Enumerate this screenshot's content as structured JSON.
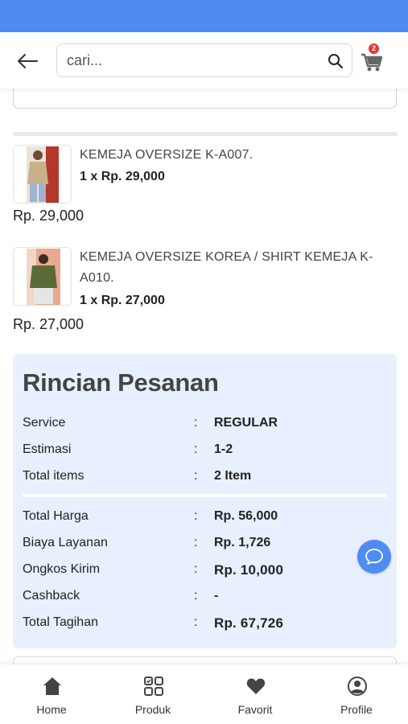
{
  "search": {
    "placeholder": "cari..."
  },
  "cart": {
    "badge_count": "2"
  },
  "products": [
    {
      "name": "KEMEJA OVERSIZE K-A007.",
      "qty_price": "1 x Rp. 29,000",
      "total": "Rp. 29,000",
      "thumb_color": "#c8b08a"
    },
    {
      "name": "KEMEJA OVERSIZE KOREA / SHIRT KEMEJA K-A010.",
      "qty_price": "1 x Rp. 27,000",
      "total": "Rp. 27,000",
      "thumb_color": "#5b6b35"
    }
  ],
  "summary": {
    "title": "Rincian Pesanan",
    "separator": ":",
    "rows": [
      {
        "label": "Service",
        "value": "REGULAR"
      },
      {
        "label": "Estimasi",
        "value": "1-2"
      },
      {
        "label": "Total items",
        "value": "2 Item"
      },
      {
        "label": "Total Harga",
        "value": "Rp. 56,000"
      },
      {
        "label": "Biaya Layanan",
        "value": "Rp. 1,726"
      },
      {
        "label": "Ongkos Kirim",
        "value": "Rp. 10,000"
      },
      {
        "label": "Cashback",
        "value": "-"
      },
      {
        "label": "Total Tagihan",
        "value": "Rp. 67,726"
      }
    ]
  },
  "nav": {
    "items": [
      {
        "label": "Home",
        "icon": "home-icon"
      },
      {
        "label": "Produk",
        "icon": "grid-icon"
      },
      {
        "label": "Favorit",
        "icon": "heart-icon"
      },
      {
        "label": "Profile",
        "icon": "user-icon"
      }
    ]
  },
  "colors": {
    "accent": "#4e8cf2",
    "summary_bg": "#e8f0fd",
    "badge": "#e53935"
  }
}
